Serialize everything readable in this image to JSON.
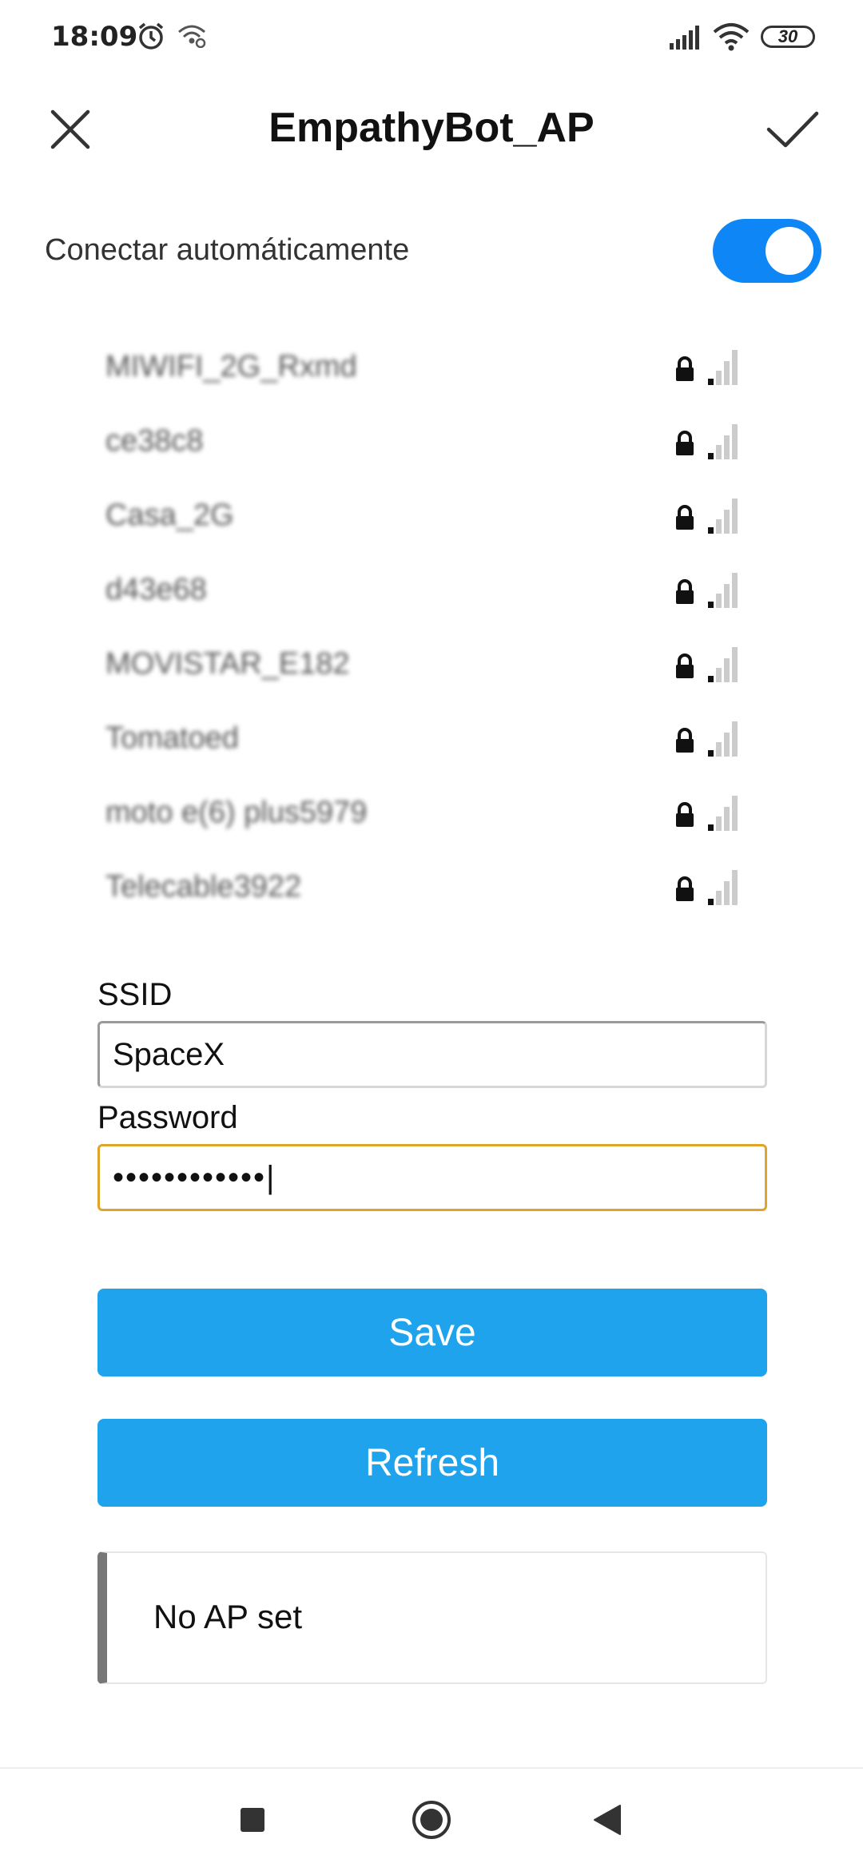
{
  "status_bar": {
    "time": "18:09",
    "battery": "30",
    "icons": [
      "alarm-icon",
      "hotspot-icon",
      "cellular-signal-icon",
      "wifi-icon",
      "battery-icon"
    ]
  },
  "header": {
    "title": "EmpathyBot_AP",
    "close_icon": "close-icon",
    "confirm_icon": "check-icon"
  },
  "auto_connect": {
    "label": "Conectar automáticamente",
    "enabled": true,
    "accent_color": "#0f86f5"
  },
  "networks": [
    {
      "name": "MIWIFI_2G_Rxmd",
      "secured": true,
      "signal": 1
    },
    {
      "name": "ce38c8",
      "secured": true,
      "signal": 1
    },
    {
      "name": "Casa_2G",
      "secured": true,
      "signal": 1
    },
    {
      "name": "d43e68",
      "secured": true,
      "signal": 1
    },
    {
      "name": "MOVISTAR_E182",
      "secured": true,
      "signal": 1
    },
    {
      "name": "Tomatoed",
      "secured": true,
      "signal": 1
    },
    {
      "name": "moto e(6) plus5979",
      "secured": true,
      "signal": 1
    },
    {
      "name": "Telecable3922",
      "secured": true,
      "signal": 1
    }
  ],
  "form": {
    "ssid_label": "SSID",
    "ssid_value": "SpaceX",
    "password_label": "Password",
    "password_value": "••••••••••••|"
  },
  "buttons": {
    "save_label": "Save",
    "refresh_label": "Refresh",
    "button_color": "#1fa3ec"
  },
  "message": {
    "text": "No AP set"
  },
  "nav_bar": {
    "icons": [
      "recents-square-icon",
      "home-circle-icon",
      "back-triangle-icon"
    ]
  }
}
